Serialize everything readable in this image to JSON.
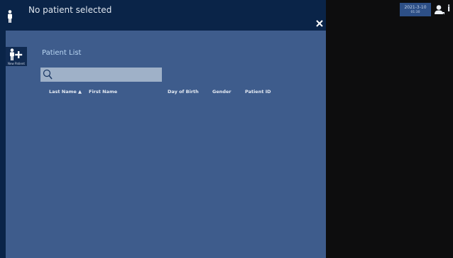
{
  "header": {
    "title": "No patient selected",
    "icons": {
      "patient": "person-icon",
      "close": "close-icon"
    }
  },
  "sidebar": {
    "new_patient_label": "New Patient",
    "icon": "add-person-icon"
  },
  "patient_list": {
    "title": "Patient List",
    "search": {
      "value": "",
      "placeholder": "",
      "icon": "search-icon"
    },
    "columns": [
      {
        "label": "Last Name ▲",
        "sorted": "ascending"
      },
      {
        "label": "First Name"
      },
      {
        "label": "Day of Birth"
      },
      {
        "label": "Gender"
      },
      {
        "label": "Patient ID"
      }
    ],
    "rows": []
  },
  "status": {
    "date": "2021-3-10",
    "time": "01:30",
    "icons": [
      "user-settings-icon",
      "info-icon"
    ]
  },
  "colors": {
    "header_bg": "#0a2448",
    "panel_bg": "#3e5c8c",
    "search_bg": "#9fb1c8",
    "list_title": "#b9d6f2",
    "clock_bg": "#2d4f86",
    "background": "#0d0d0e"
  }
}
